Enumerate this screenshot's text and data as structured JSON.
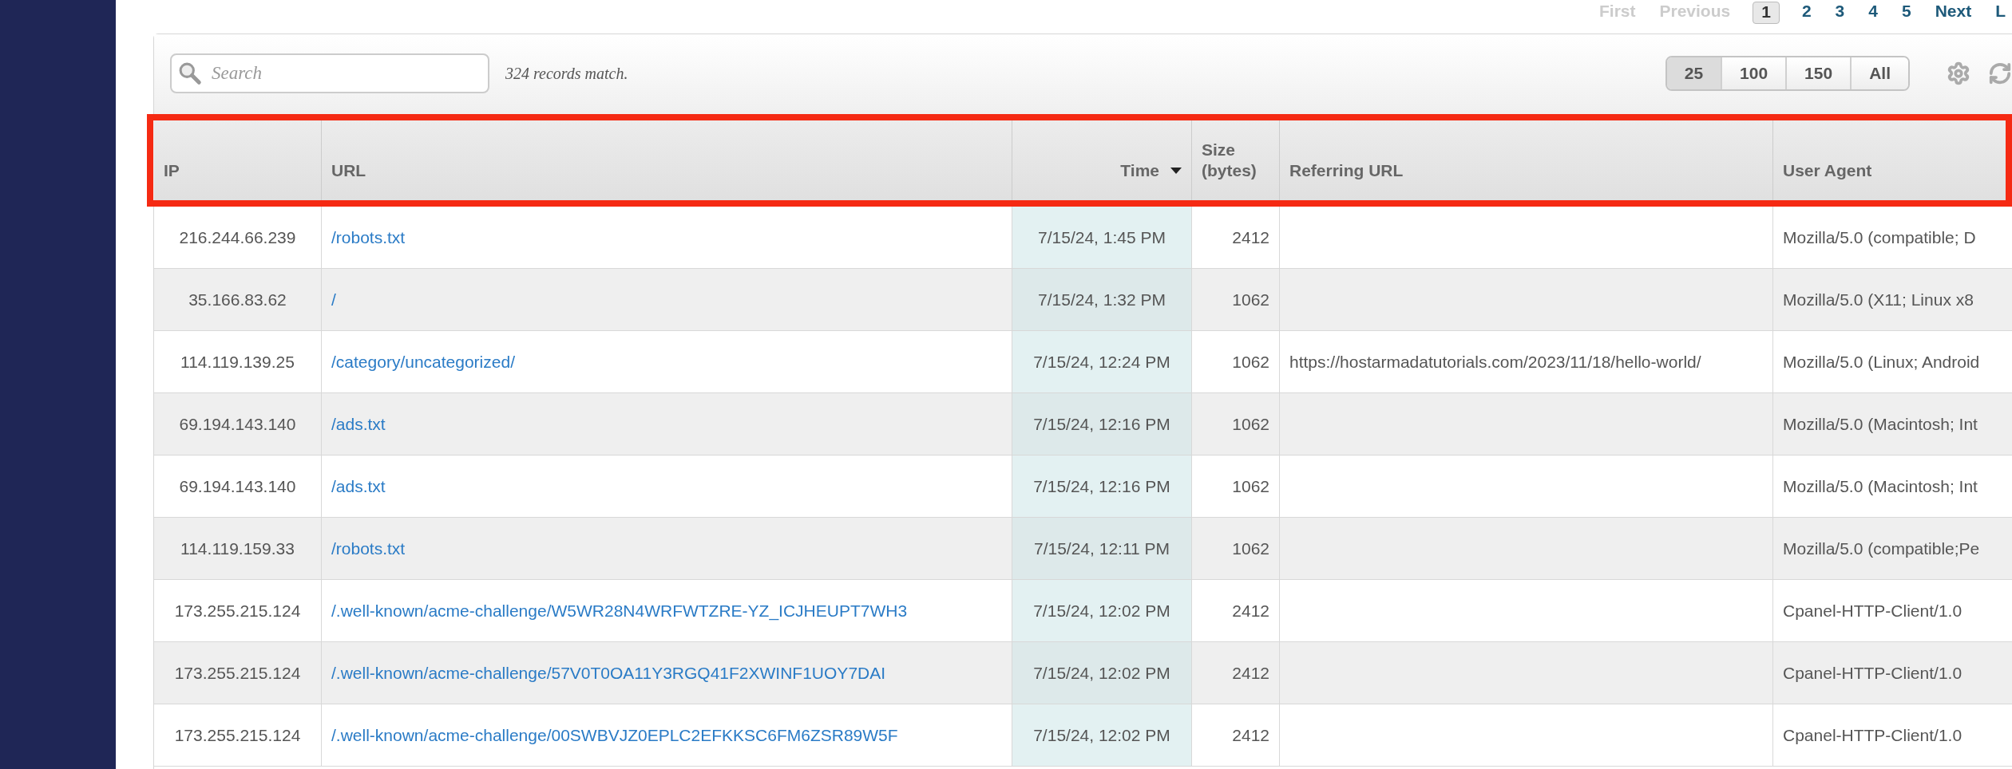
{
  "pagination": [
    {
      "label": "First",
      "selected": false,
      "disabled": true
    },
    {
      "label": "Previous",
      "selected": false,
      "disabled": true
    },
    {
      "label": "1",
      "selected": true,
      "disabled": false
    },
    {
      "label": "2",
      "selected": false,
      "disabled": false
    },
    {
      "label": "3",
      "selected": false,
      "disabled": false
    },
    {
      "label": "4",
      "selected": false,
      "disabled": false
    },
    {
      "label": "5",
      "selected": false,
      "disabled": false
    },
    {
      "label": "Next",
      "selected": false,
      "disabled": false
    },
    {
      "label": "L",
      "selected": false,
      "disabled": false
    }
  ],
  "search": {
    "placeholder": "Search"
  },
  "record_count": "324 records match.",
  "page_sizes": [
    {
      "label": "25",
      "selected": true
    },
    {
      "label": "100",
      "selected": false
    },
    {
      "label": "150",
      "selected": false
    },
    {
      "label": "All",
      "selected": false
    }
  ],
  "table": {
    "header_highlighted": true,
    "columns": [
      {
        "label": "IP",
        "sorted": false
      },
      {
        "label": "URL",
        "sorted": false
      },
      {
        "label": "Time",
        "sorted": true
      },
      {
        "label": "Size (bytes)",
        "sorted": false
      },
      {
        "label": "Referring URL",
        "sorted": false
      },
      {
        "label": "User Agent",
        "sorted": false
      }
    ],
    "rows": [
      {
        "ip": "216.244.66.239",
        "url": "/robots.txt",
        "time": "7/15/24, 1:45 PM",
        "size": "2412",
        "referrer": "",
        "user_agent": "Mozilla/5.0 (compatible; D"
      },
      {
        "ip": "35.166.83.62",
        "url": "/",
        "time": "7/15/24, 1:32 PM",
        "size": "1062",
        "referrer": "",
        "user_agent": "Mozilla/5.0 (X11; Linux x8"
      },
      {
        "ip": "114.119.139.25",
        "url": "/category/uncategorized/",
        "time": "7/15/24, 12:24 PM",
        "size": "1062",
        "referrer": "https://hostarmadatutorials.com/2023/11/18/hello-world/",
        "user_agent": "Mozilla/5.0 (Linux; Android"
      },
      {
        "ip": "69.194.143.140",
        "url": "/ads.txt",
        "time": "7/15/24, 12:16 PM",
        "size": "1062",
        "referrer": "",
        "user_agent": "Mozilla/5.0 (Macintosh; Int"
      },
      {
        "ip": "69.194.143.140",
        "url": "/ads.txt",
        "time": "7/15/24, 12:16 PM",
        "size": "1062",
        "referrer": "",
        "user_agent": "Mozilla/5.0 (Macintosh; Int"
      },
      {
        "ip": "114.119.159.33",
        "url": "/robots.txt",
        "time": "7/15/24, 12:11 PM",
        "size": "1062",
        "referrer": "",
        "user_agent": "Mozilla/5.0 (compatible;Pe"
      },
      {
        "ip": "173.255.215.124",
        "url": "/.well-known/acme-challenge/W5WR28N4WRFWTZRE-YZ_ICJHEUPT7WH3",
        "time": "7/15/24, 12:02 PM",
        "size": "2412",
        "referrer": "",
        "user_agent": "Cpanel-HTTP-Client/1.0"
      },
      {
        "ip": "173.255.215.124",
        "url": "/.well-known/acme-challenge/57V0T0OA11Y3RGQ41F2XWINF1UOY7DAI",
        "time": "7/15/24, 12:02 PM",
        "size": "2412",
        "referrer": "",
        "user_agent": "Cpanel-HTTP-Client/1.0"
      },
      {
        "ip": "173.255.215.124",
        "url": "/.well-known/acme-challenge/00SWBVJZ0EPLC2EFKKSC6FM6ZSR89W5F",
        "time": "7/15/24, 12:02 PM",
        "size": "2412",
        "referrer": "",
        "user_agent": "Cpanel-HTTP-Client/1.0"
      }
    ]
  }
}
